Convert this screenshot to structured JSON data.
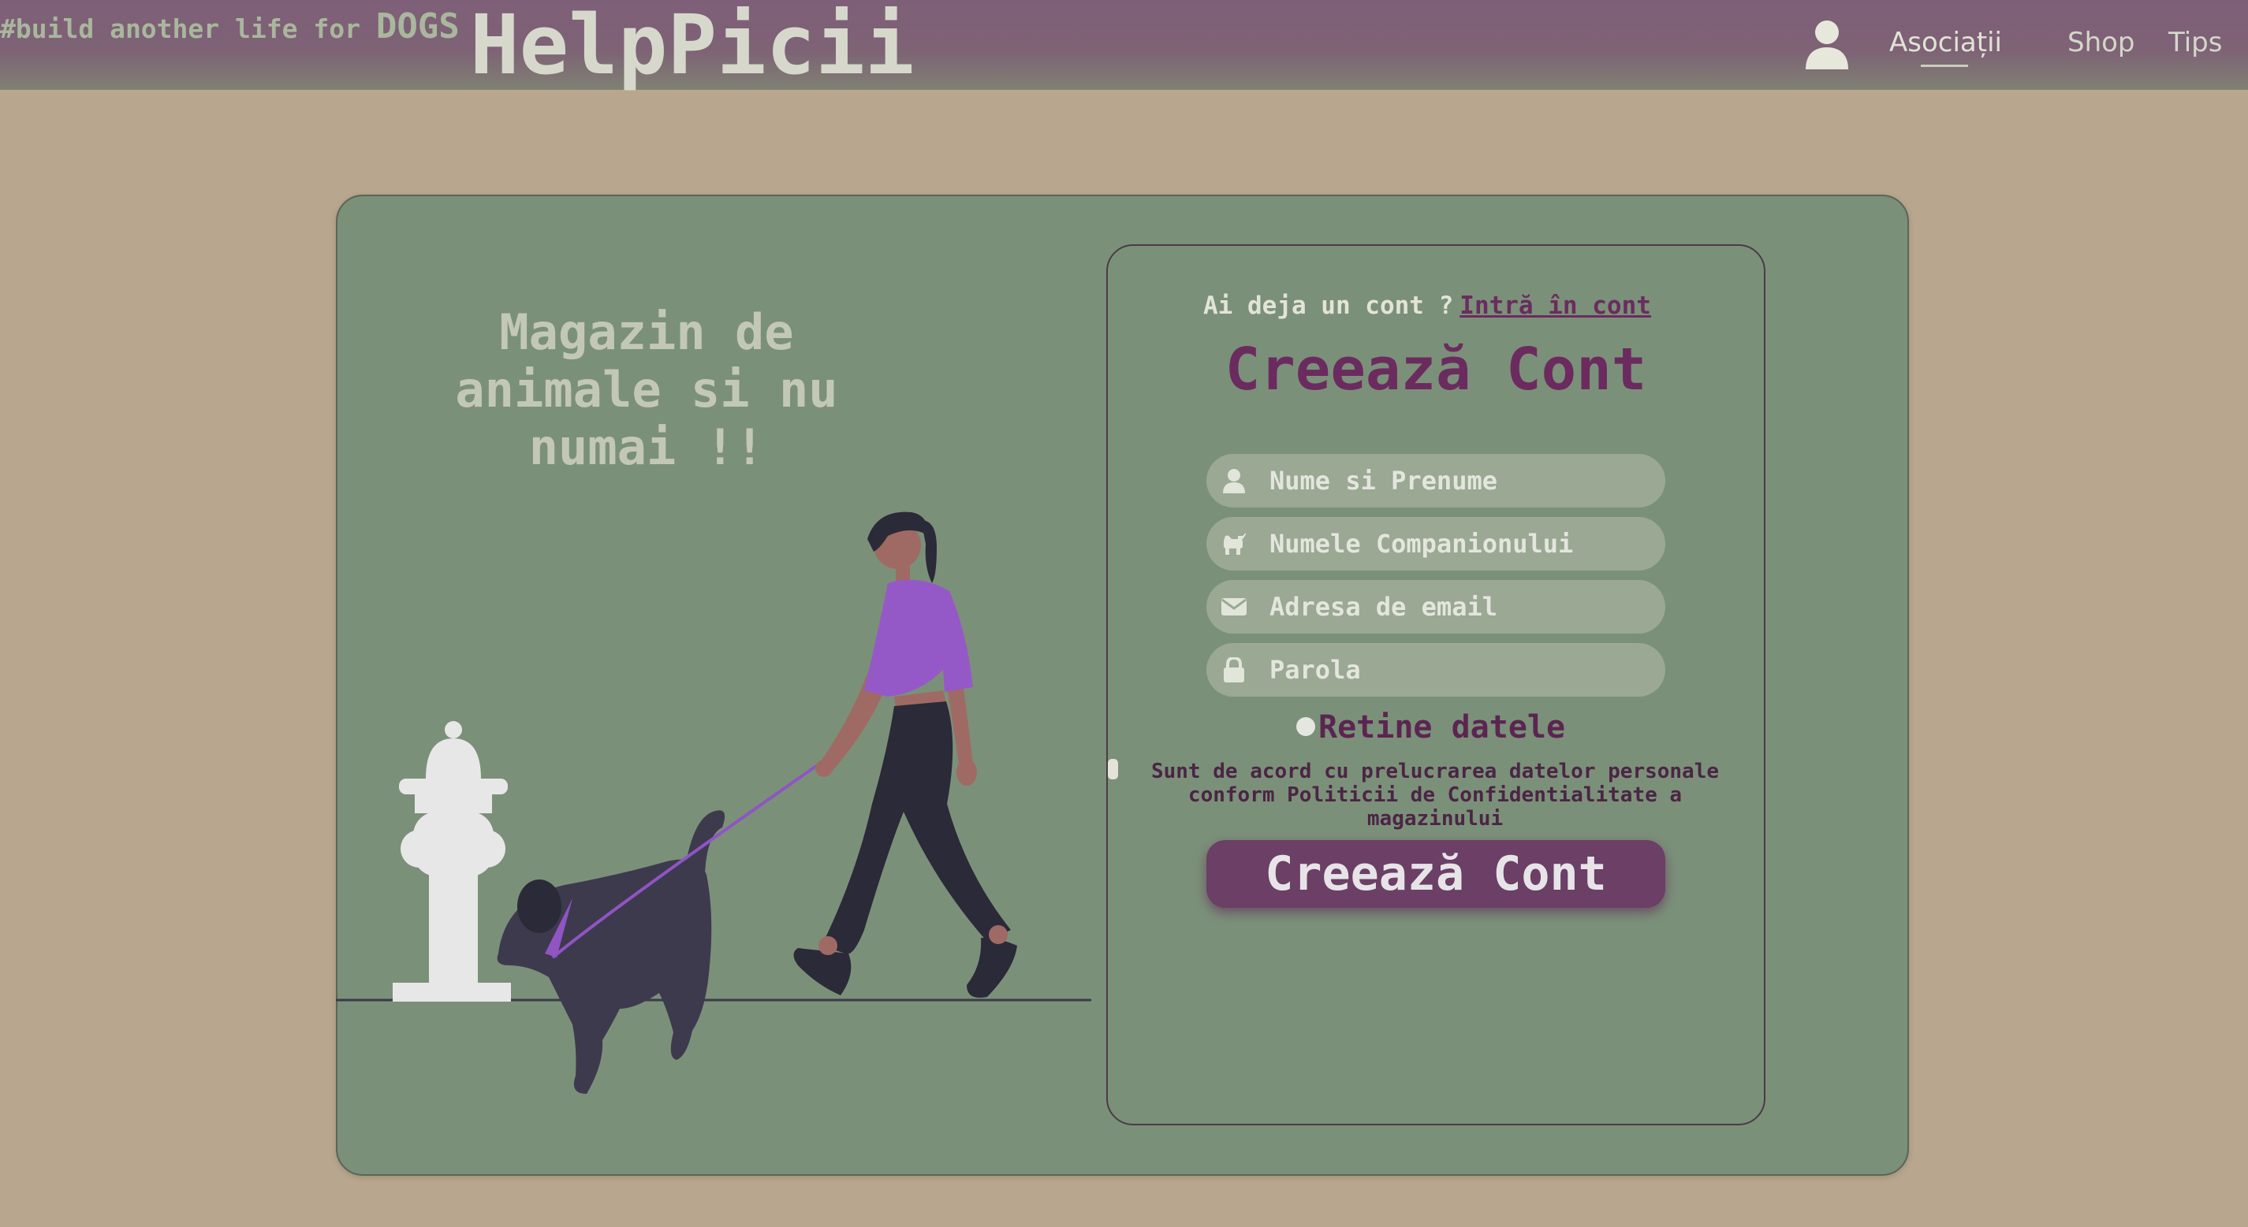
{
  "header": {
    "tagline_prefix": "#build another life for ",
    "tagline_dogs": "DOGS",
    "brand": "HelpPicii",
    "nav": [
      "Asociații",
      "Shop",
      "Tips"
    ],
    "user_icon": "user-icon"
  },
  "hero": {
    "headline": "Magazin de animale si nu numai !!"
  },
  "form": {
    "have_account": "Ai deja un cont ?",
    "login_link": "Intră în cont",
    "title": "Creează Cont",
    "fields": [
      {
        "placeholder": "Nume si Prenume",
        "icon": "user-icon"
      },
      {
        "placeholder": "Numele Companionului",
        "icon": "dog-icon"
      },
      {
        "placeholder": "Adresa de email",
        "icon": "envelope-icon"
      },
      {
        "placeholder": "Parola",
        "icon": "lock-icon"
      }
    ],
    "remember": "Retine datele",
    "consent": "Sunt de acord cu prelucrarea datelor personale conform Politicii de Confidentialitate a magazinului",
    "submit": "Creează Cont"
  },
  "colors": {
    "page_bg": "#b9a68e",
    "card_bg": "#7b9079",
    "accent": "#6b2b5f",
    "button": "#6b3f66",
    "field_bg": "#9aa894"
  }
}
